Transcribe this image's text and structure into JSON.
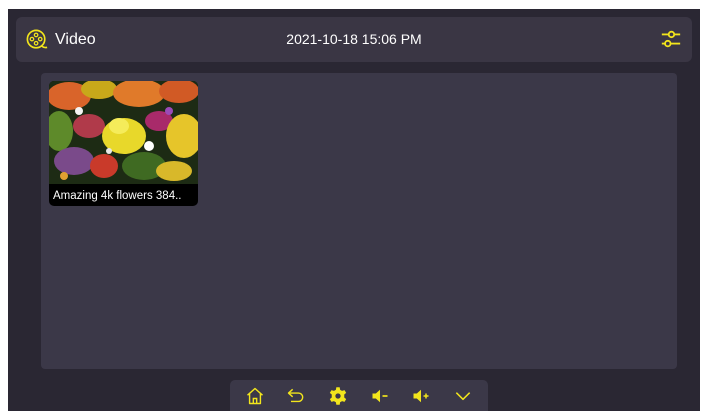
{
  "header": {
    "title": "Video",
    "datetime": "2021-10-18 15:06 PM"
  },
  "videos": [
    {
      "caption": "Amazing 4k flowers 384.."
    }
  ],
  "colors": {
    "accent": "#f2e51c",
    "background": "#2a2733",
    "panel": "#3b3848"
  },
  "icons": {
    "app": "film-reel-icon",
    "settings": "sliders-icon",
    "nav": [
      "home-icon",
      "back-icon",
      "gear-icon",
      "volume-down-icon",
      "volume-up-icon",
      "chevron-down-icon"
    ]
  }
}
